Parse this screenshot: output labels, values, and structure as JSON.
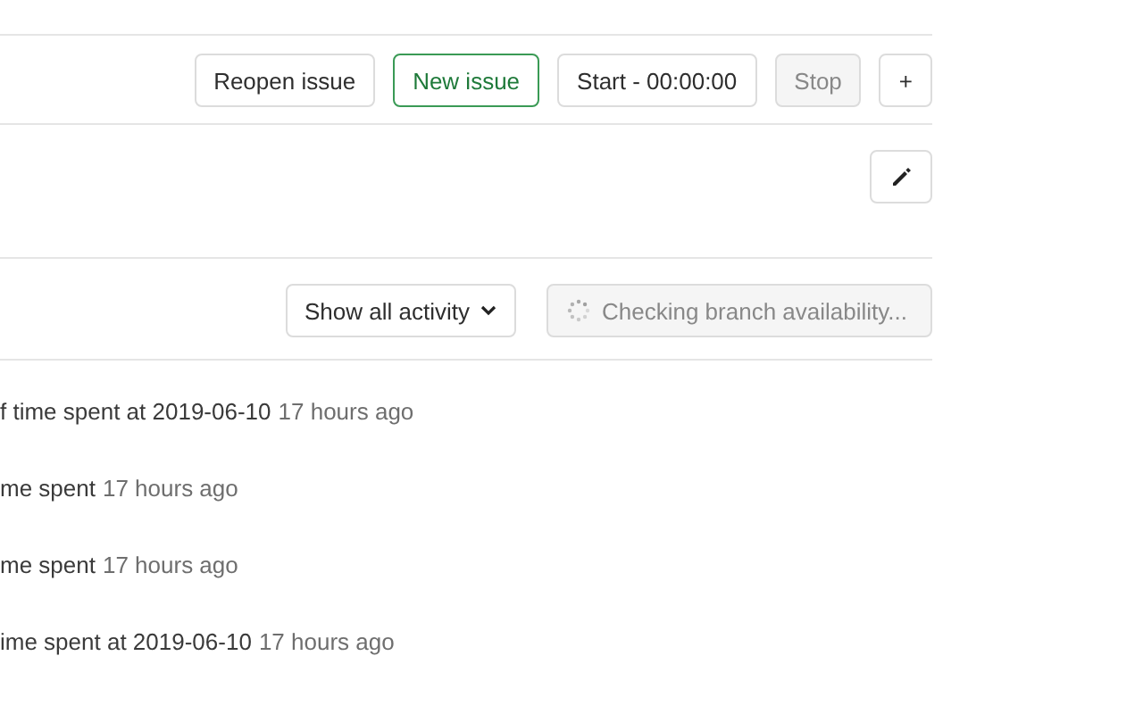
{
  "actions": [
    {
      "label": "Reopen issue",
      "kind": "default",
      "disabled": false
    },
    {
      "label": "New issue",
      "kind": "success",
      "disabled": false
    },
    {
      "label": "Start - 00:00:00",
      "kind": "default",
      "disabled": false
    },
    {
      "label": "Stop",
      "kind": "default",
      "disabled": true
    },
    {
      "label": "+",
      "kind": "default",
      "disabled": false
    }
  ],
  "activity_filter": {
    "label": "Show all activity"
  },
  "branch_button": {
    "label": "Checking branch availability...",
    "disabled": true
  },
  "notes": [
    {
      "text": "f time spent at 2019-06-10",
      "time": "17 hours ago"
    },
    {
      "text": "me spent",
      "time": "17 hours ago"
    },
    {
      "text": "me spent",
      "time": "17 hours ago"
    },
    {
      "text": "ime spent at 2019-06-10",
      "time": "17 hours ago"
    }
  ]
}
